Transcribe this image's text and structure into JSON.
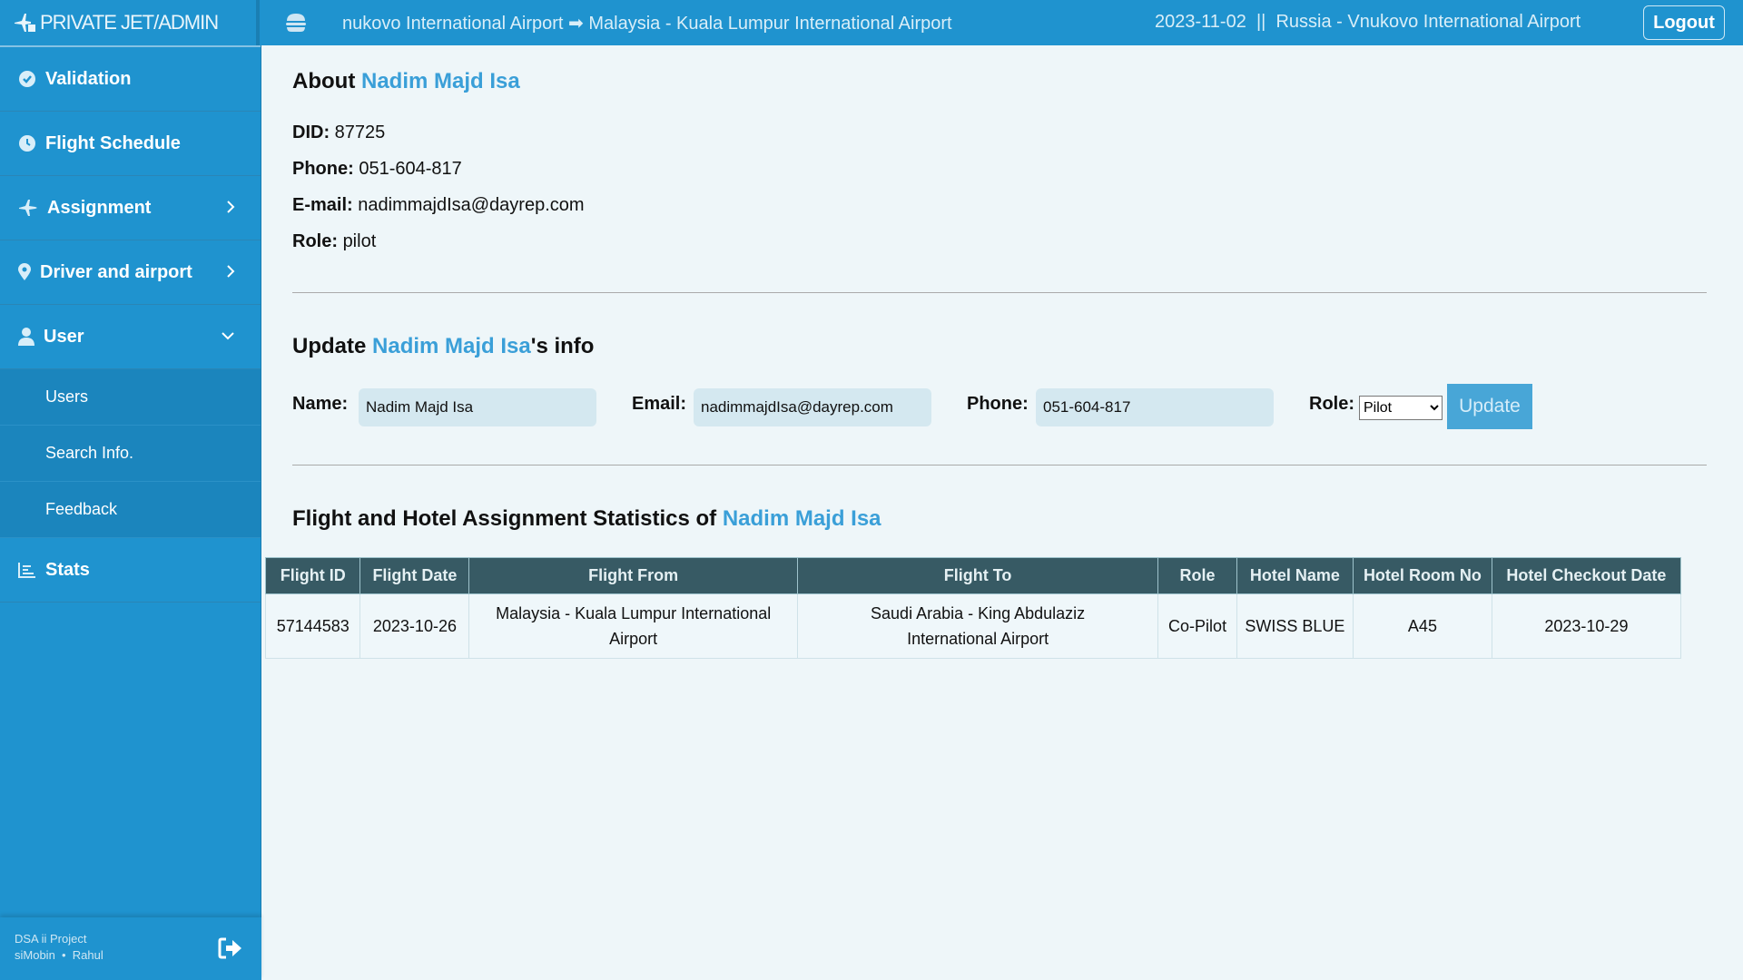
{
  "header": {
    "brand": "PRIVATE JET/ADMIN",
    "route": "nukovo International Airport ➡ Malaysia - Kuala Lumpur International Airport",
    "date": "2023-11-02",
    "separator": "||",
    "location": "Russia - Vnukovo International Airport",
    "logout_label": "Logout"
  },
  "sidebar": {
    "items": [
      {
        "label": "Validation",
        "icon": "check-circle-icon"
      },
      {
        "label": "Flight Schedule",
        "icon": "clock-icon"
      },
      {
        "label": "Assignment",
        "icon": "plane-icon"
      },
      {
        "label": "Driver and airport",
        "icon": "map-pin-icon"
      },
      {
        "label": "User",
        "icon": "user-icon"
      }
    ],
    "sub_items": [
      "Users",
      "Search Info.",
      "Feedback"
    ],
    "stats": "Stats",
    "footer": {
      "line1": "DSA ii Project",
      "line2": "siMobin  •  Rahul"
    }
  },
  "about": {
    "prefix": "About ",
    "name": "Nadim Majd Isa",
    "did_label": "DID:",
    "did": "87725",
    "phone_label": "Phone:",
    "phone": "051-604-817",
    "email_label": "E-mail:",
    "email": "nadimmajdIsa@dayrep.com",
    "role_label": "Role:",
    "role": "pilot"
  },
  "update": {
    "prefix": "Update ",
    "name": "Nadim Majd Isa",
    "suffix": "'s info",
    "name_label": "Name:",
    "name_value": "Nadim Majd Isa",
    "email_label": "Email:",
    "email_value": "nadimmajdIsa@dayrep.com",
    "phone_label": "Phone:",
    "phone_value": "051-604-817",
    "role_label": "Role:",
    "role_value": "Pilot",
    "button": "Update"
  },
  "stats": {
    "prefix": "Flight and Hotel Assignment Statistics of ",
    "name": "Nadim Majd Isa",
    "columns": [
      "Flight ID",
      "Flight Date",
      "Flight From",
      "Flight To",
      "Role",
      "Hotel Name",
      "Hotel Room No",
      "Hotel Checkout Date"
    ],
    "rows": [
      [
        "57144583",
        "2023-10-26",
        "Malaysia - Kuala Lumpur International Airport",
        "Saudi Arabia - King Abdulaziz International Airport",
        "Co-Pilot",
        "SWISS BLUE",
        "A45",
        "2023-10-29"
      ]
    ]
  },
  "colors": {
    "primary": "#1f93cf",
    "table_header": "#375a64",
    "accent": "#3a9fd8"
  }
}
